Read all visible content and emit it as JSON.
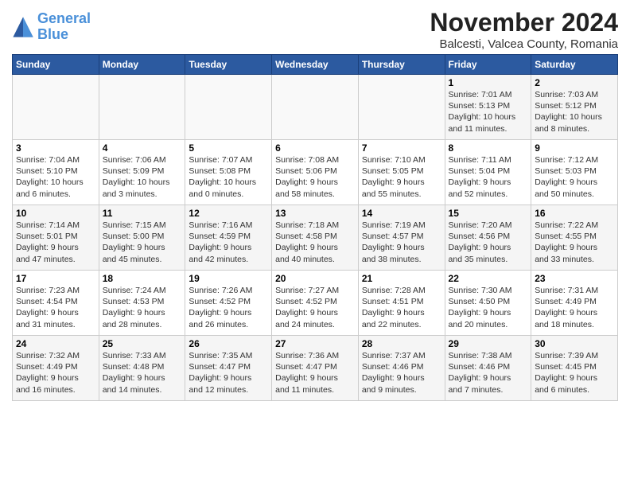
{
  "header": {
    "logo_line1": "General",
    "logo_line2": "Blue",
    "month": "November 2024",
    "location": "Balcesti, Valcea County, Romania"
  },
  "weekdays": [
    "Sunday",
    "Monday",
    "Tuesday",
    "Wednesday",
    "Thursday",
    "Friday",
    "Saturday"
  ],
  "rows": [
    [
      {
        "day": "",
        "info": ""
      },
      {
        "day": "",
        "info": ""
      },
      {
        "day": "",
        "info": ""
      },
      {
        "day": "",
        "info": ""
      },
      {
        "day": "",
        "info": ""
      },
      {
        "day": "1",
        "info": "Sunrise: 7:01 AM\nSunset: 5:13 PM\nDaylight: 10 hours\nand 11 minutes."
      },
      {
        "day": "2",
        "info": "Sunrise: 7:03 AM\nSunset: 5:12 PM\nDaylight: 10 hours\nand 8 minutes."
      }
    ],
    [
      {
        "day": "3",
        "info": "Sunrise: 7:04 AM\nSunset: 5:10 PM\nDaylight: 10 hours\nand 6 minutes."
      },
      {
        "day": "4",
        "info": "Sunrise: 7:06 AM\nSunset: 5:09 PM\nDaylight: 10 hours\nand 3 minutes."
      },
      {
        "day": "5",
        "info": "Sunrise: 7:07 AM\nSunset: 5:08 PM\nDaylight: 10 hours\nand 0 minutes."
      },
      {
        "day": "6",
        "info": "Sunrise: 7:08 AM\nSunset: 5:06 PM\nDaylight: 9 hours\nand 58 minutes."
      },
      {
        "day": "7",
        "info": "Sunrise: 7:10 AM\nSunset: 5:05 PM\nDaylight: 9 hours\nand 55 minutes."
      },
      {
        "day": "8",
        "info": "Sunrise: 7:11 AM\nSunset: 5:04 PM\nDaylight: 9 hours\nand 52 minutes."
      },
      {
        "day": "9",
        "info": "Sunrise: 7:12 AM\nSunset: 5:03 PM\nDaylight: 9 hours\nand 50 minutes."
      }
    ],
    [
      {
        "day": "10",
        "info": "Sunrise: 7:14 AM\nSunset: 5:01 PM\nDaylight: 9 hours\nand 47 minutes."
      },
      {
        "day": "11",
        "info": "Sunrise: 7:15 AM\nSunset: 5:00 PM\nDaylight: 9 hours\nand 45 minutes."
      },
      {
        "day": "12",
        "info": "Sunrise: 7:16 AM\nSunset: 4:59 PM\nDaylight: 9 hours\nand 42 minutes."
      },
      {
        "day": "13",
        "info": "Sunrise: 7:18 AM\nSunset: 4:58 PM\nDaylight: 9 hours\nand 40 minutes."
      },
      {
        "day": "14",
        "info": "Sunrise: 7:19 AM\nSunset: 4:57 PM\nDaylight: 9 hours\nand 38 minutes."
      },
      {
        "day": "15",
        "info": "Sunrise: 7:20 AM\nSunset: 4:56 PM\nDaylight: 9 hours\nand 35 minutes."
      },
      {
        "day": "16",
        "info": "Sunrise: 7:22 AM\nSunset: 4:55 PM\nDaylight: 9 hours\nand 33 minutes."
      }
    ],
    [
      {
        "day": "17",
        "info": "Sunrise: 7:23 AM\nSunset: 4:54 PM\nDaylight: 9 hours\nand 31 minutes."
      },
      {
        "day": "18",
        "info": "Sunrise: 7:24 AM\nSunset: 4:53 PM\nDaylight: 9 hours\nand 28 minutes."
      },
      {
        "day": "19",
        "info": "Sunrise: 7:26 AM\nSunset: 4:52 PM\nDaylight: 9 hours\nand 26 minutes."
      },
      {
        "day": "20",
        "info": "Sunrise: 7:27 AM\nSunset: 4:52 PM\nDaylight: 9 hours\nand 24 minutes."
      },
      {
        "day": "21",
        "info": "Sunrise: 7:28 AM\nSunset: 4:51 PM\nDaylight: 9 hours\nand 22 minutes."
      },
      {
        "day": "22",
        "info": "Sunrise: 7:30 AM\nSunset: 4:50 PM\nDaylight: 9 hours\nand 20 minutes."
      },
      {
        "day": "23",
        "info": "Sunrise: 7:31 AM\nSunset: 4:49 PM\nDaylight: 9 hours\nand 18 minutes."
      }
    ],
    [
      {
        "day": "24",
        "info": "Sunrise: 7:32 AM\nSunset: 4:49 PM\nDaylight: 9 hours\nand 16 minutes."
      },
      {
        "day": "25",
        "info": "Sunrise: 7:33 AM\nSunset: 4:48 PM\nDaylight: 9 hours\nand 14 minutes."
      },
      {
        "day": "26",
        "info": "Sunrise: 7:35 AM\nSunset: 4:47 PM\nDaylight: 9 hours\nand 12 minutes."
      },
      {
        "day": "27",
        "info": "Sunrise: 7:36 AM\nSunset: 4:47 PM\nDaylight: 9 hours\nand 11 minutes."
      },
      {
        "day": "28",
        "info": "Sunrise: 7:37 AM\nSunset: 4:46 PM\nDaylight: 9 hours\nand 9 minutes."
      },
      {
        "day": "29",
        "info": "Sunrise: 7:38 AM\nSunset: 4:46 PM\nDaylight: 9 hours\nand 7 minutes."
      },
      {
        "day": "30",
        "info": "Sunrise: 7:39 AM\nSunset: 4:45 PM\nDaylight: 9 hours\nand 6 minutes."
      }
    ]
  ]
}
